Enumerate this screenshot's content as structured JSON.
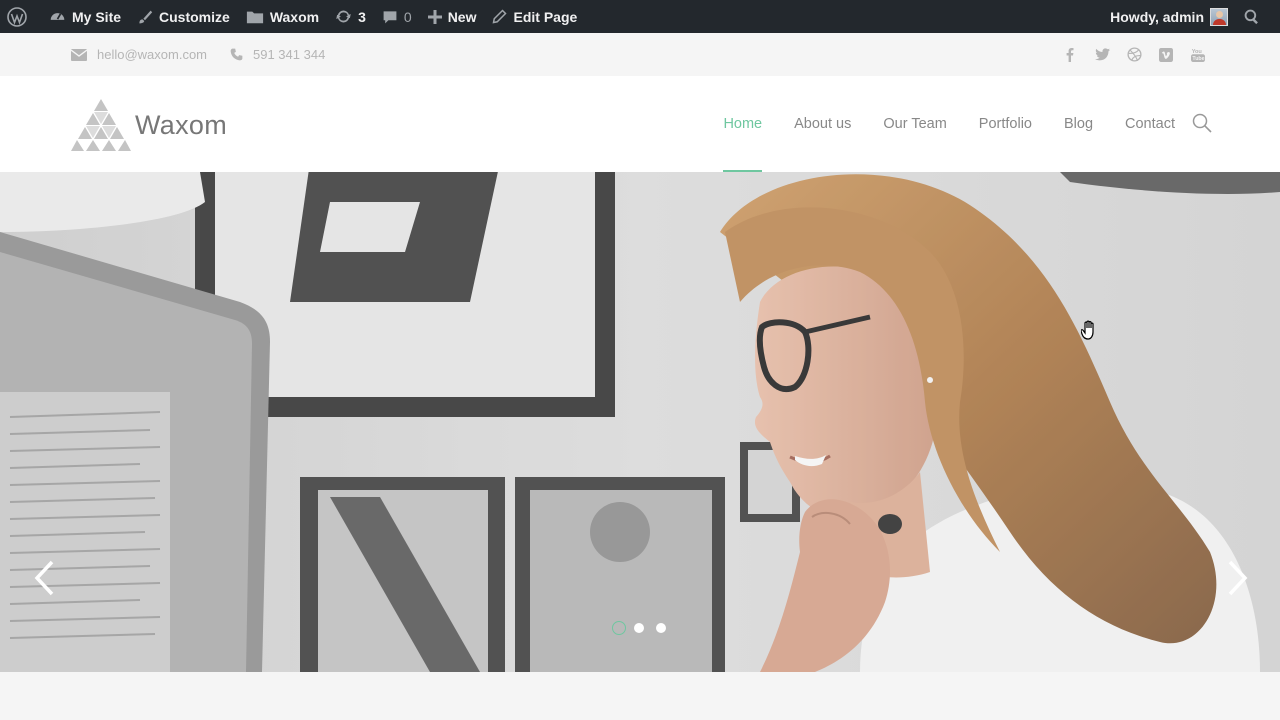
{
  "adminbar": {
    "my_site": "My Site",
    "customize": "Customize",
    "site_name": "Waxom",
    "updates_count": "3",
    "comments_count": "0",
    "new_label": "New",
    "edit_page": "Edit Page",
    "greeting": "Howdy, admin"
  },
  "topbar": {
    "email": "hello@waxom.com",
    "phone": "591 341 344",
    "social": [
      "facebook-icon",
      "twitter-icon",
      "dribbble-icon",
      "vimeo-icon",
      "youtube-icon"
    ]
  },
  "header": {
    "logo_text": "Waxom",
    "nav": [
      {
        "label": "Home",
        "active": true
      },
      {
        "label": "About us"
      },
      {
        "label": "Our Team"
      },
      {
        "label": "Portfolio"
      },
      {
        "label": "Blog"
      },
      {
        "label": "Contact"
      }
    ]
  },
  "slider": {
    "slide_count": 3,
    "active_slide": 1
  },
  "colors": {
    "accent": "#6fc7a0",
    "adminbar_bg": "#23282d",
    "nav_text": "#888888"
  }
}
